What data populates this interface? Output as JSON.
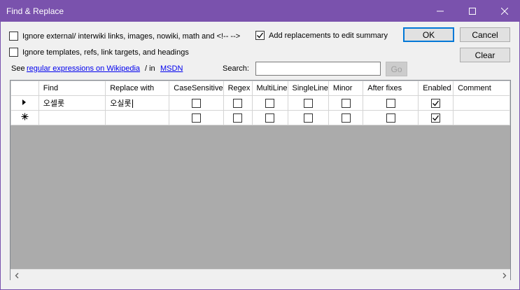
{
  "window": {
    "title": "Find & Replace"
  },
  "options": {
    "ignore_external": "Ignore external/ interwiki links, images, nowiki, math and <!-- -->",
    "ignore_templates": "Ignore templates, refs, link targets, and headings",
    "add_replacements": "Add replacements to edit summary",
    "ignore_external_checked": false,
    "ignore_templates_checked": false,
    "add_replacements_checked": true
  },
  "help": {
    "see": "See",
    "regex_link": "regular expressions on Wikipedia",
    "sep": "/ in",
    "msdn_link": "MSDN"
  },
  "search": {
    "label": "Search:",
    "value": "",
    "go": "Go"
  },
  "buttons": {
    "ok": "OK",
    "cancel": "Cancel",
    "clear": "Clear"
  },
  "grid": {
    "columns": [
      "Find",
      "Replace with",
      "CaseSensitive",
      "Regex",
      "MultiLine",
      "SingleLine",
      "Minor",
      "After fixes",
      "Enabled",
      "Comment"
    ],
    "rows": [
      {
        "find": "오셀롯",
        "replace": "오실롯",
        "case": false,
        "regex": false,
        "multi": false,
        "single": false,
        "minor": false,
        "after": false,
        "enabled": true,
        "comment": ""
      },
      {
        "find": "",
        "replace": "",
        "case": false,
        "regex": false,
        "multi": false,
        "single": false,
        "minor": false,
        "after": false,
        "enabled": true,
        "comment": ""
      }
    ],
    "row_markers": [
      "current-row-arrow",
      "new-row-asterisk"
    ]
  }
}
